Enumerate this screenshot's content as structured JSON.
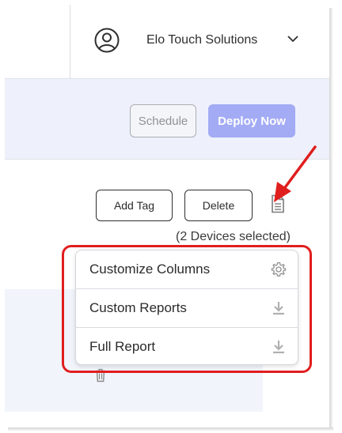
{
  "header": {
    "account_name": "Elo Touch Solutions",
    "user_icon": "user-circle-icon",
    "chevron_icon": "chevron-down-icon"
  },
  "actions": {
    "schedule_label": "Schedule",
    "deploy_label": "Deploy Now"
  },
  "toolbar": {
    "add_tag_label": "Add Tag",
    "delete_label": "Delete",
    "report_icon": "document-icon",
    "selected_text": "(2 Devices selected)"
  },
  "dropdown": {
    "items": [
      {
        "label": "Customize Columns",
        "icon": "gear-icon"
      },
      {
        "label": "Custom Reports",
        "icon": "download-icon"
      },
      {
        "label": "Full Report",
        "icon": "download-icon"
      }
    ]
  },
  "colors": {
    "accent": "#a3abf5",
    "band": "#eef1fb",
    "annotation": "#e01e1e"
  }
}
